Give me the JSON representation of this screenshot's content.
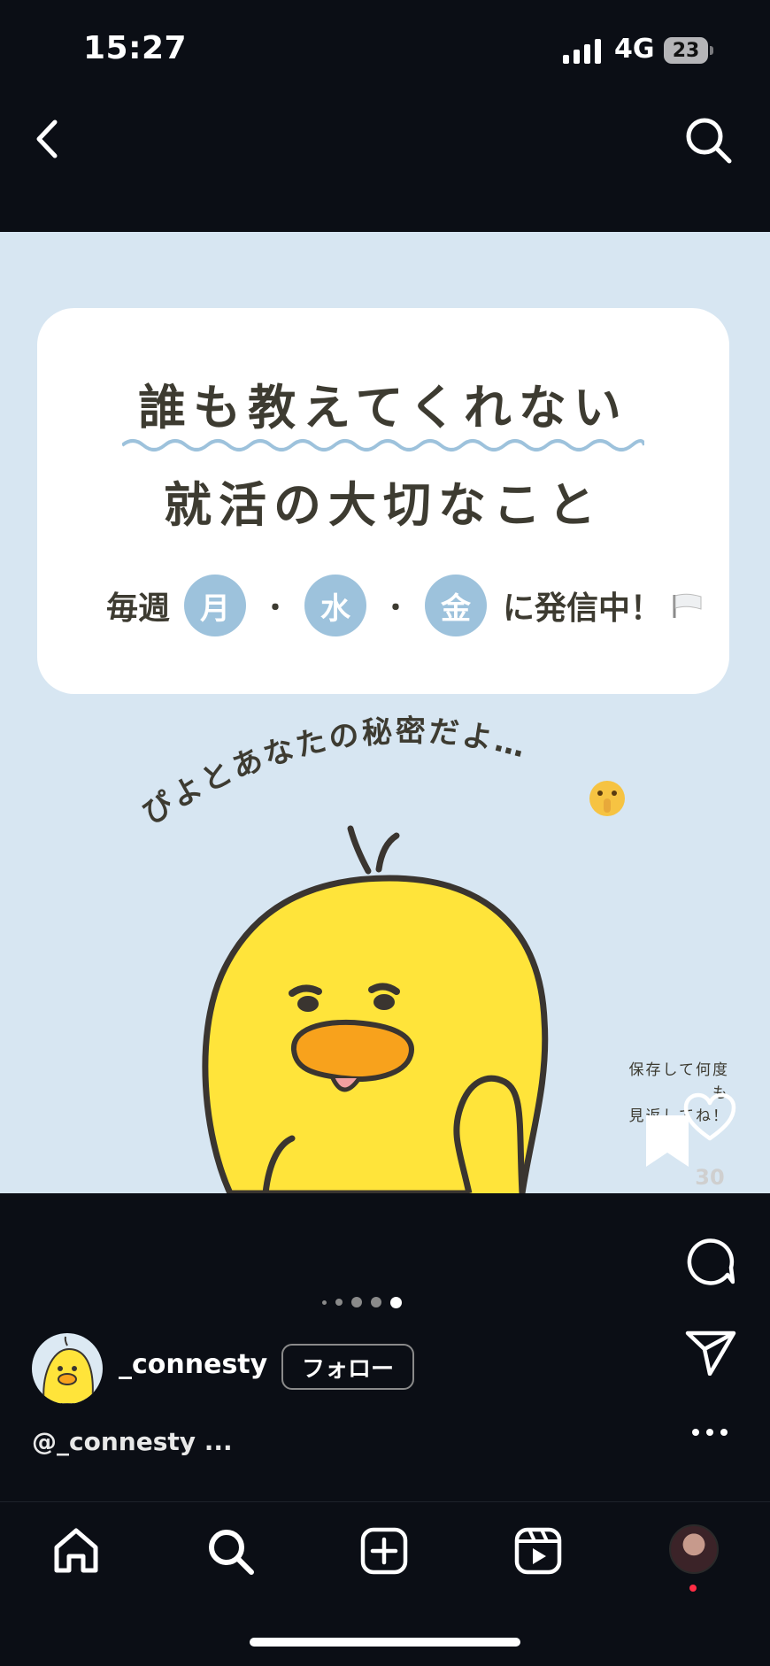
{
  "status_bar": {
    "time": "15:27",
    "network": "4G",
    "battery": "23"
  },
  "post": {
    "card_title_line1": "誰も教えてくれない",
    "card_title_line2": "就活の大切なこと",
    "schedule_prefix": "毎週",
    "days": [
      "月",
      "水",
      "金"
    ],
    "separator": "・",
    "schedule_suffix": "に発信中！",
    "secret_text": "ぴよとあなたの秘密だよ…",
    "save_note_line1": "保存して何度も",
    "save_note_line2": "見返してね！",
    "like_count": "30"
  },
  "carousel": {
    "count": 5,
    "active_index": 4
  },
  "account": {
    "username": "_connesty",
    "follow_label": "フォロー",
    "caption": "@_connesty ..."
  },
  "colors": {
    "background": "#0b0e15",
    "post_background": "#d7e6f2",
    "day_badge": "#9dc2dc",
    "chick_yellow": "#ffe43a",
    "notification_dot": "#ff2d45"
  },
  "icons": {
    "back": "chevron-left-icon",
    "search": "search-icon",
    "like": "heart-icon",
    "comment": "comment-icon",
    "share": "paper-plane-icon",
    "more": "more-horizontal-icon",
    "nav": [
      "home-icon",
      "search-icon",
      "plus-square-icon",
      "reels-icon",
      "profile-avatar"
    ]
  }
}
